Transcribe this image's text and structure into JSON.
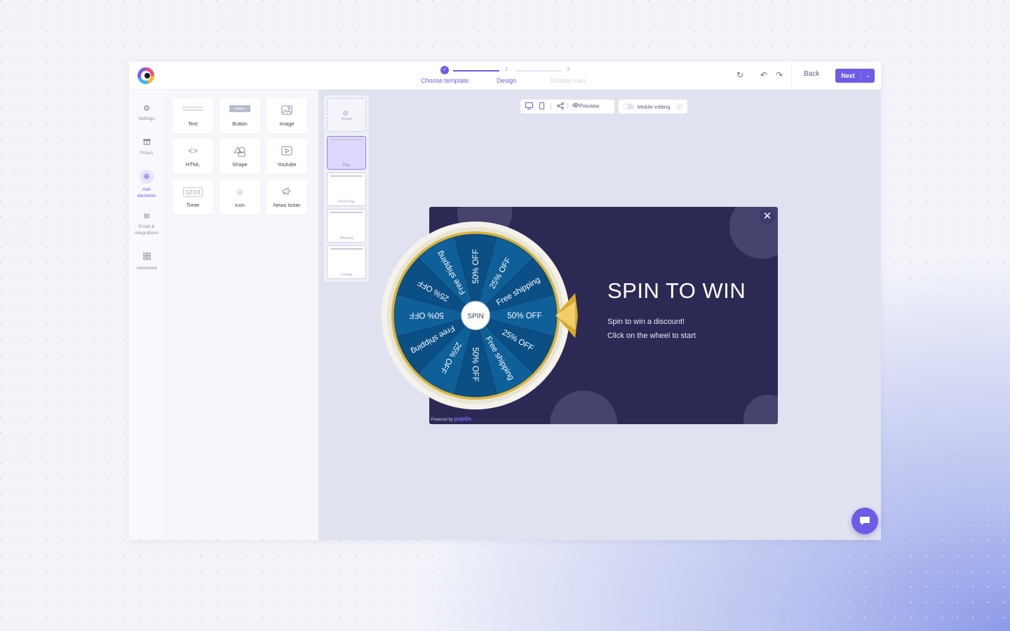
{
  "header": {
    "steps": [
      {
        "num": "",
        "label": "Choose template"
      },
      {
        "num": "2",
        "label": "Design"
      },
      {
        "num": "3",
        "label": "Display rules"
      }
    ],
    "back_label": "Back",
    "next_label": "Next",
    "check_icon": "check-icon"
  },
  "leftnav": {
    "items": [
      {
        "label": "Settings",
        "icon": "gear-icon"
      },
      {
        "label": "Prizes",
        "icon": "gift-icon"
      },
      {
        "label": "Add elements",
        "icon": "plus-circle-icon"
      },
      {
        "label": "Email & integrations",
        "icon": "mail-icon"
      },
      {
        "label": "Advanced",
        "icon": "grid-icon"
      }
    ]
  },
  "elements": {
    "tiles": [
      {
        "label": "Text"
      },
      {
        "label": "Button"
      },
      {
        "label": "Image"
      },
      {
        "label": "HTML"
      },
      {
        "label": "Shape"
      },
      {
        "label": "Youtube"
      },
      {
        "label": "Timer",
        "icon_text": "12:03"
      },
      {
        "label": "Icon"
      },
      {
        "label": "News ticker"
      }
    ]
  },
  "canvas": {
    "pages": [
      {
        "label": "Teaser"
      },
      {
        "label": "Play"
      },
      {
        "label": "Post-Play"
      },
      {
        "label": "Winning"
      },
      {
        "label": "Losing"
      }
    ],
    "toolbar": {
      "preview_label": "Preview",
      "mobile_editing_label": "Mobile editing"
    }
  },
  "popup": {
    "title": "SPIN TO WIN",
    "subtitle_line1": "Spin to win a discount!",
    "subtitle_line2": "Click on the wheel to start",
    "powered_by": "Powered by",
    "brand": "poptin",
    "close_symbol": "✕",
    "background_color": "#2c2a55"
  },
  "wheel": {
    "center_label": "SPIN",
    "segments": [
      "50% OFF",
      "25% OFF",
      "Free shipping",
      "50% OFF",
      "25% OFF",
      "Free shipping",
      "50% OFF",
      "25% OFF",
      "Free shipping",
      "50% OFF",
      "25% OFF",
      "Free shipping"
    ],
    "colors": [
      "#0b4f85",
      "#0f5f99"
    ],
    "rim_color": "#d9b43b"
  }
}
